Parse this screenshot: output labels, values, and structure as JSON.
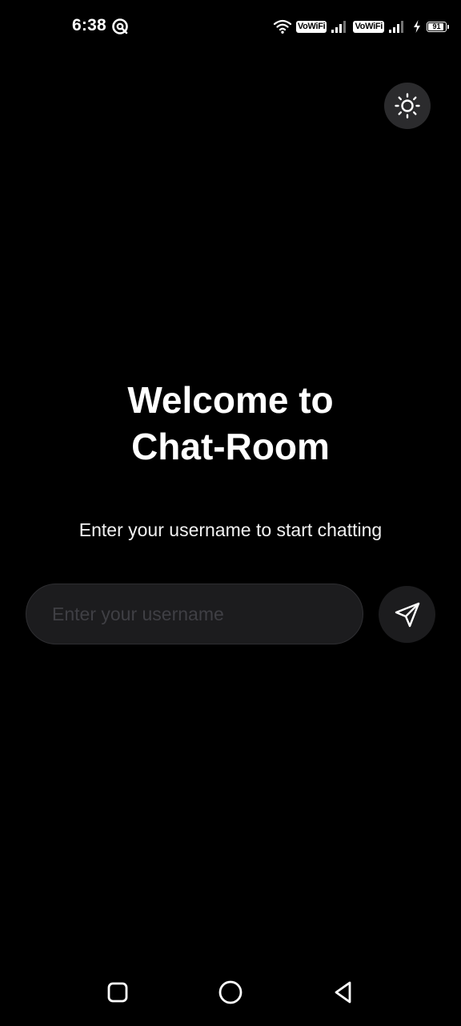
{
  "status_bar": {
    "time": "6:38",
    "network_badges": [
      "VoWiFi",
      "VoWiFi"
    ],
    "battery_level": 91,
    "battery_text": "91",
    "icons": [
      "app-notification-icon",
      "wifi-icon",
      "signal-icon",
      "charging-icon",
      "battery-icon"
    ]
  },
  "theme_toggle": {
    "icon": "sun-icon"
  },
  "welcome": {
    "title_line1": "Welcome to",
    "title_line2": "Chat-Room",
    "subtitle": "Enter your username to start chatting"
  },
  "username": {
    "value": "",
    "placeholder": "Enter your username"
  },
  "send_button": {
    "icon": "send-icon"
  },
  "navigation": {
    "items": [
      "recent-apps-icon",
      "home-icon",
      "back-icon"
    ]
  },
  "colors": {
    "background": "#000000",
    "text": "#ffffff",
    "input_background": "#1c1c1e",
    "placeholder": "#3f3f44",
    "toggle_background": "#2b2b2d"
  }
}
